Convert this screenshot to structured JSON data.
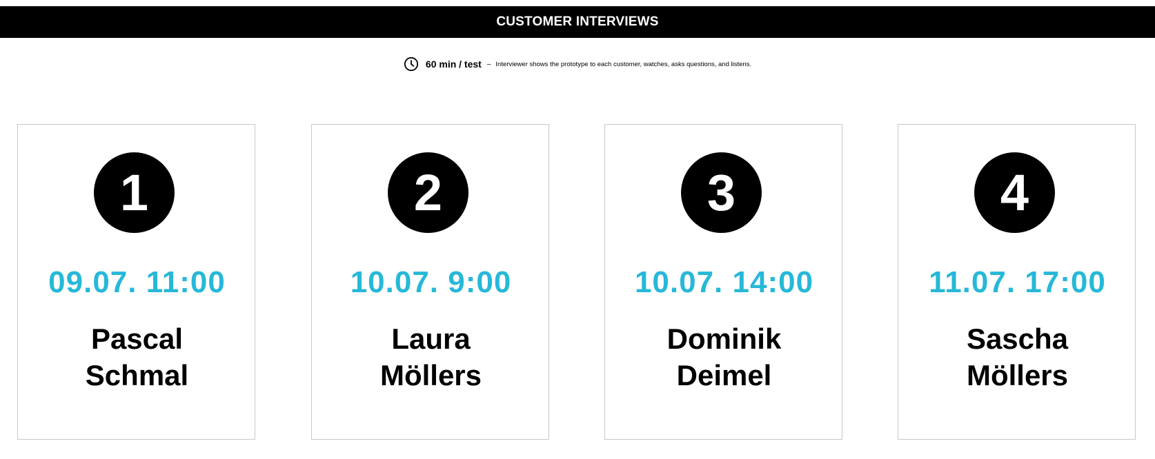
{
  "header": {
    "title": "CUSTOMER INTERVIEWS"
  },
  "info": {
    "icon": "clock-icon",
    "duration": "60 min / test",
    "separator": "–",
    "description": "Interviewer shows the prototype to each customer, watches, asks questions, and listens."
  },
  "colors": {
    "accent": "#27b8d8",
    "header_bg": "#000000",
    "card_border": "#c8c8c8"
  },
  "interviews": [
    {
      "number": "1",
      "slot": "09.07. 11:00",
      "first_name": "Pascal",
      "last_name": "Schmal"
    },
    {
      "number": "2",
      "slot": "10.07. 9:00",
      "first_name": "Laura",
      "last_name": "Möllers"
    },
    {
      "number": "3",
      "slot": "10.07. 14:00",
      "first_name": "Dominik",
      "last_name": "Deimel"
    },
    {
      "number": "4",
      "slot": "11.07. 17:00",
      "first_name": "Sascha",
      "last_name": "Möllers"
    }
  ]
}
